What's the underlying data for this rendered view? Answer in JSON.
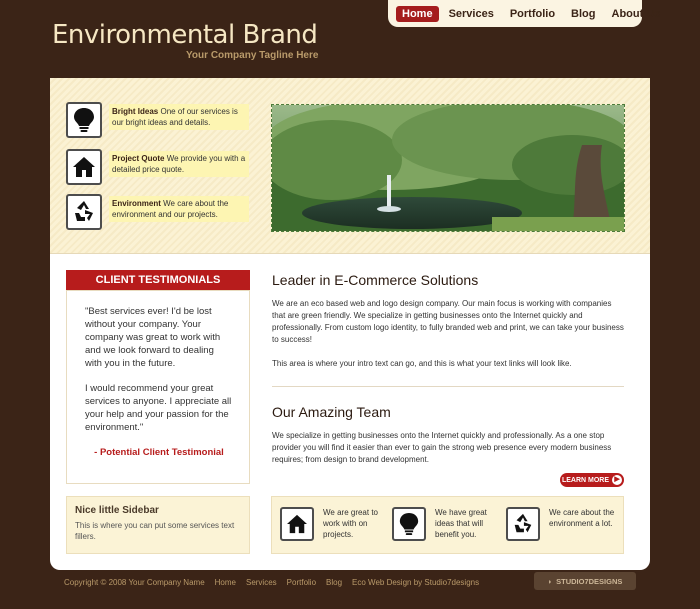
{
  "brand": {
    "title": "Environmental Brand",
    "tagline": "Your Company Tagline Here"
  },
  "nav": {
    "items": [
      {
        "label": "Home",
        "active": true
      },
      {
        "label": "Services",
        "active": false
      },
      {
        "label": "Portfolio",
        "active": false
      },
      {
        "label": "Blog",
        "active": false
      },
      {
        "label": "About Us",
        "active": false
      }
    ]
  },
  "features": [
    {
      "icon": "lightbulb-icon",
      "title": "Bright Ideas",
      "text": "One of our services is our bright ideas and details."
    },
    {
      "icon": "house-icon",
      "title": "Project Quote",
      "text": "We provide you with a detailed price quote."
    },
    {
      "icon": "recycle-icon",
      "title": "Environment",
      "text": "We care about the environment and our projects."
    }
  ],
  "testimonials": {
    "heading": "CLIENT TESTIMONIALS",
    "quote1": "\"Best services ever! I'd be lost without your company. Your company was great to work with and we look forward to dealing with you in the future.",
    "quote2": "I would recommend your great services to anyone. I appreciate all your help and your passion for the environment.\"",
    "signature": "- Potential Client Testimonial"
  },
  "sidebar": {
    "title": "Nice little Sidebar",
    "text": "This is where you can put some services text fillers."
  },
  "intro": {
    "heading": "Leader in E-Commerce Solutions",
    "para1": "We are an eco based web and logo design company. Our main focus is working with companies that are green friendly. We specialize in getting businesses onto the Internet quickly and professionally. From custom logo identity, to fully branded web and print, we can take your business to success!",
    "para2": "This area is where your intro text can go, and this is what your text links will look like."
  },
  "team": {
    "heading": "Our Amazing Team",
    "para": "We specialize in getting businesses onto the Internet quickly and professionally. As a one stop provider you will find it easier than ever to gain the strong web presence every modern business requires; from design to brand development.",
    "more_label": "LEARN MORE"
  },
  "services": [
    {
      "icon": "house-icon",
      "text": "We are great to work with on projects."
    },
    {
      "icon": "lightbulb-icon",
      "text": "We have great ideas that will benefit you."
    },
    {
      "icon": "recycle-icon",
      "text": "We care about the environment a lot."
    }
  ],
  "footer": {
    "copyright": "Copyright © 2008 Your Company Name",
    "links": [
      "Home",
      "Services",
      "Portfolio",
      "Blog"
    ],
    "credit": "Eco Web Design by Studio7designs",
    "studio_logo": "STUDIO7DESIGNS"
  },
  "colors": {
    "background": "#3b2417",
    "accent": "#b71c1c",
    "cream": "#fbf3d6",
    "highlight": "#fdf5b2"
  }
}
